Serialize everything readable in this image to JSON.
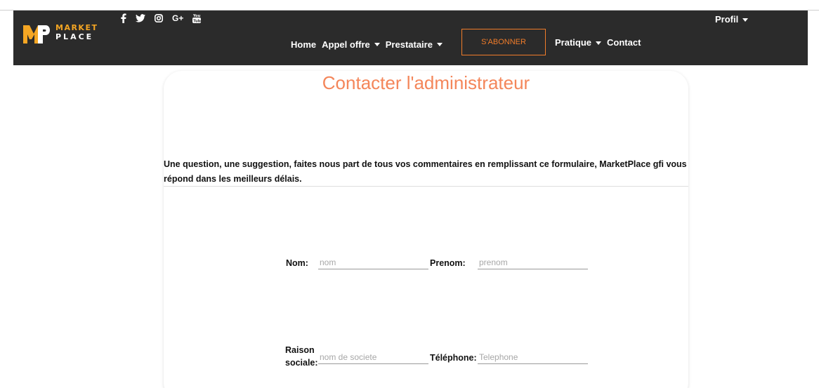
{
  "brand": {
    "line1": "MARKET",
    "line2": "PLACE"
  },
  "social": [
    {
      "name": "facebook-icon",
      "glyph": "f"
    },
    {
      "name": "twitter-icon",
      "glyph": "twitter"
    },
    {
      "name": "instagram-icon",
      "glyph": "instagram"
    },
    {
      "name": "google-plus-icon",
      "glyph": "G+"
    },
    {
      "name": "youtube-icon",
      "glyph": "youtube"
    }
  ],
  "nav": {
    "home": "Home",
    "appel_offre": "Appel offre",
    "prestataire": "Prestataire",
    "subscribe": "S'ABONNER",
    "pratique": "Pratique",
    "contact": "Contact",
    "profil": "Profil"
  },
  "page": {
    "title": "Contacter l'administrateur",
    "intro": "Une question, une suggestion, faites nous part de tous vos commentaires en remplissant ce formulaire, MarketPlace gfi vous répond dans les meilleurs délais."
  },
  "form": {
    "nom_label": "Nom:",
    "nom_placeholder": "nom",
    "prenom_label": "Prenom:",
    "prenom_placeholder": "prenom",
    "raison_label_1": "Raison",
    "raison_label_2": "sociale:",
    "raison_placeholder": "nom de societe",
    "telephone_label": "Téléphone:",
    "telephone_placeholder": "Telephone"
  },
  "colors": {
    "navbar_bg": "#2b2b2b",
    "accent_orange": "#f07c2a",
    "title_orange": "#f4865a",
    "logo_yellow": "#f5a623"
  }
}
